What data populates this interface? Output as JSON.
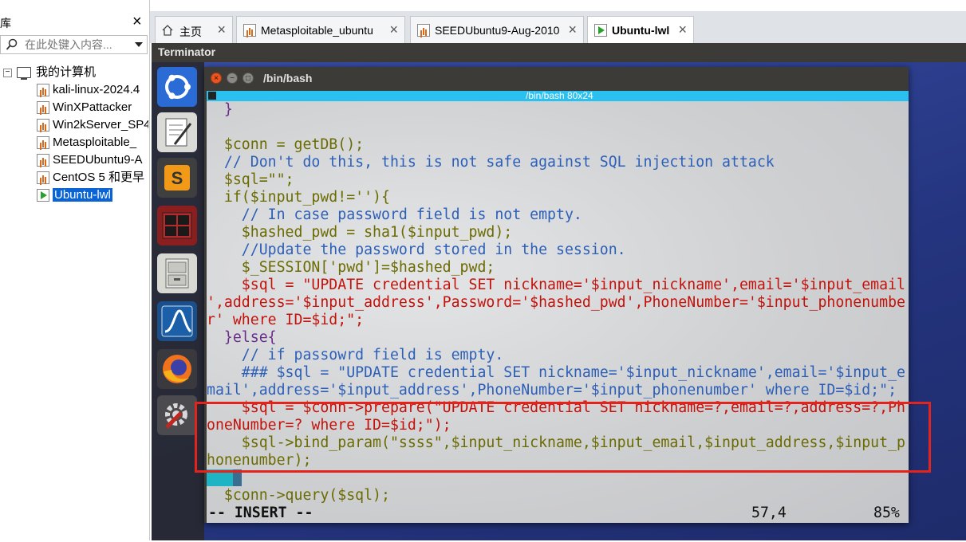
{
  "library": {
    "title": "库",
    "close": "×",
    "search_placeholder": "在此处键入内容...",
    "root": "我的计算机",
    "items": [
      {
        "label": "kali-linux-2024.4",
        "state": "stopped"
      },
      {
        "label": "WinXPattacker",
        "state": "stopped"
      },
      {
        "label": "Win2kServer_SP4",
        "state": "stopped"
      },
      {
        "label": "Metasploitable_",
        "state": "stopped"
      },
      {
        "label": "SEEDUbuntu9-A",
        "state": "stopped"
      },
      {
        "label": "CentOS 5 和更早",
        "state": "stopped"
      },
      {
        "label": "Ubuntu-lwl",
        "state": "running"
      }
    ]
  },
  "tabs": [
    {
      "label": "主页",
      "icon": "home-icon"
    },
    {
      "label": "Metasploitable_ubuntu",
      "icon": "vm-icon"
    },
    {
      "label": "SEEDUbuntu9-Aug-2010",
      "icon": "vm-icon"
    },
    {
      "label": "Ubuntu-lwl",
      "icon": "vm-running-icon",
      "active": true
    }
  ],
  "ubuntu": {
    "topbar_title": "Terminator",
    "launcher": [
      "ubuntu-logo-icon",
      "text-editor-icon",
      "sublime-text-icon",
      "terminator-icon",
      "file-cabinet-icon",
      "wireshark-icon",
      "firefox-icon",
      "settings-icon"
    ]
  },
  "terminal": {
    "title": "/bin/bash",
    "geometry": "/bin/bash 80x24",
    "status_mode": "-- INSERT --",
    "status_pos": "57,4",
    "status_pct": "85%"
  },
  "code_lines": [
    "  }",
    "",
    "  $conn = getDB();",
    "  // Don't do this, this is not safe against SQL injection attack",
    "  $sql=\"\";",
    "  if($input_pwd!=''){",
    "    // In case password field is not empty.",
    "    $hashed_pwd = sha1($input_pwd);",
    "    //Update the password stored in the session.",
    "    $_SESSION['pwd']=$hashed_pwd;",
    "    $sql = \"UPDATE credential SET nickname='$input_nickname',email='$input_email",
    "',address='$input_address',Password='$hashed_pwd',PhoneNumber='$input_phonenumbe",
    "r' where ID=$id;\";",
    "  }else{",
    "    // if passowrd field is empty.",
    "    ### $sql = \"UPDATE credential SET nickname='$input_nickname',email='$input_e",
    "mail',address='$input_address',PhoneNumber='$input_phonenumber' where ID=$id;\";",
    "    $sql = $conn->prepare(\"UPDATE credential SET nickname=?,email=?,address=?,Ph",
    "oneNumber=? where ID=$id;\");",
    "    $sql->bind_param(\"ssss\",$input_nickname,$input_email,$input_address,$input_p",
    "honenumber);",
    "  }",
    "  $conn->query($sql);"
  ],
  "colors": {
    "terminal_strip": "#2ac1f0",
    "highlight_box": "#e2241d",
    "selected_item": "#0a64d6"
  }
}
